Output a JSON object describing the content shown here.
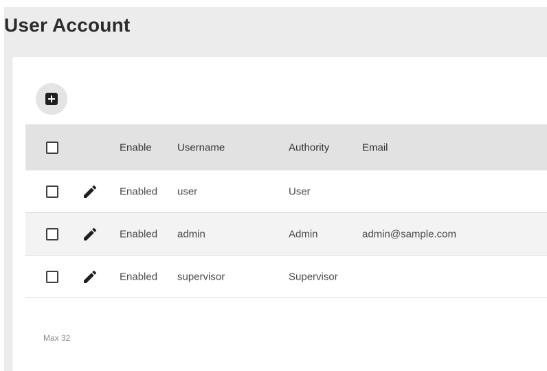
{
  "page": {
    "title": "User Account"
  },
  "toolbar": {
    "add_icon": "add-box-icon"
  },
  "table": {
    "columns": {
      "enable": "Enable",
      "username": "Username",
      "authority": "Authority",
      "email": "Email"
    },
    "rows": [
      {
        "enable": "Enabled",
        "username": "user",
        "authority": "User",
        "email": ""
      },
      {
        "enable": "Enabled",
        "username": "admin",
        "authority": "Admin",
        "email": "admin@sample.com"
      },
      {
        "enable": "Enabled",
        "username": "supervisor",
        "authority": "Supervisor",
        "email": ""
      }
    ]
  },
  "footer": {
    "note": "Max 32"
  }
}
